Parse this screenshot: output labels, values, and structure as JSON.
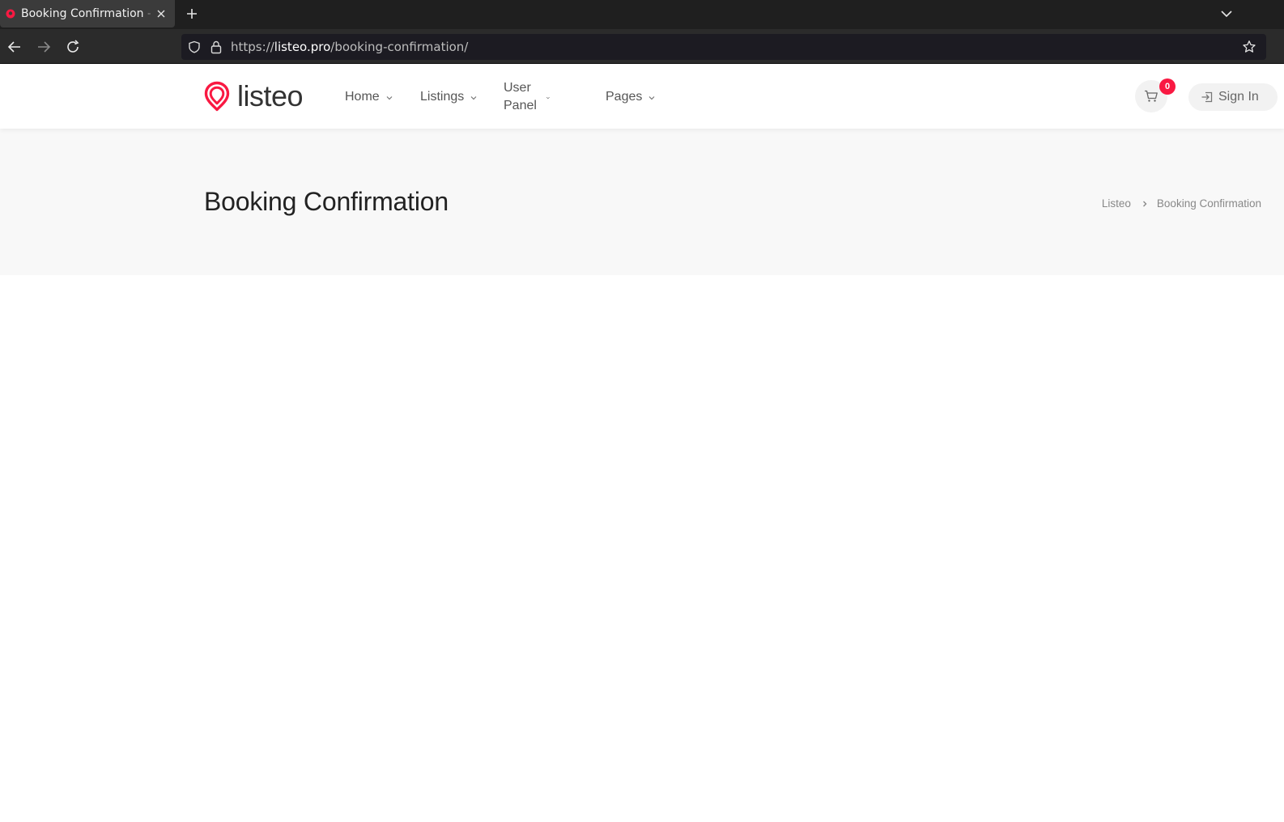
{
  "browser": {
    "tab_title": "Booking Confirmation – Listeo",
    "url_scheme": "https://",
    "url_host": "listeo.pro",
    "url_path": "/booking-confirmation/"
  },
  "header": {
    "logo_text": "listeo",
    "nav": [
      {
        "label": "Home"
      },
      {
        "label": "Listings"
      },
      {
        "label": "User Panel"
      },
      {
        "label": "Pages"
      }
    ],
    "cart_count": "0",
    "signin_label": "Sign In"
  },
  "titlebar": {
    "title": "Booking Confirmation",
    "breadcrumb": [
      "Listeo",
      "Booking Confirmation"
    ]
  },
  "colors": {
    "accent": "#f91942",
    "titlebar_bg": "#f8f8f8",
    "browser_dark": "#1f1f1f"
  },
  "icons": {
    "tab_favicon": "listeo-pin-icon",
    "tab_close": "close-icon",
    "new_tab": "plus-icon",
    "tab_list": "chevron-down-icon",
    "back": "arrow-left-icon",
    "forward": "arrow-right-icon",
    "reload": "reload-icon",
    "shield": "shield-icon",
    "lock": "lock-icon",
    "bookmark": "star-icon",
    "cart": "cart-icon",
    "signin": "sign-in-icon"
  }
}
